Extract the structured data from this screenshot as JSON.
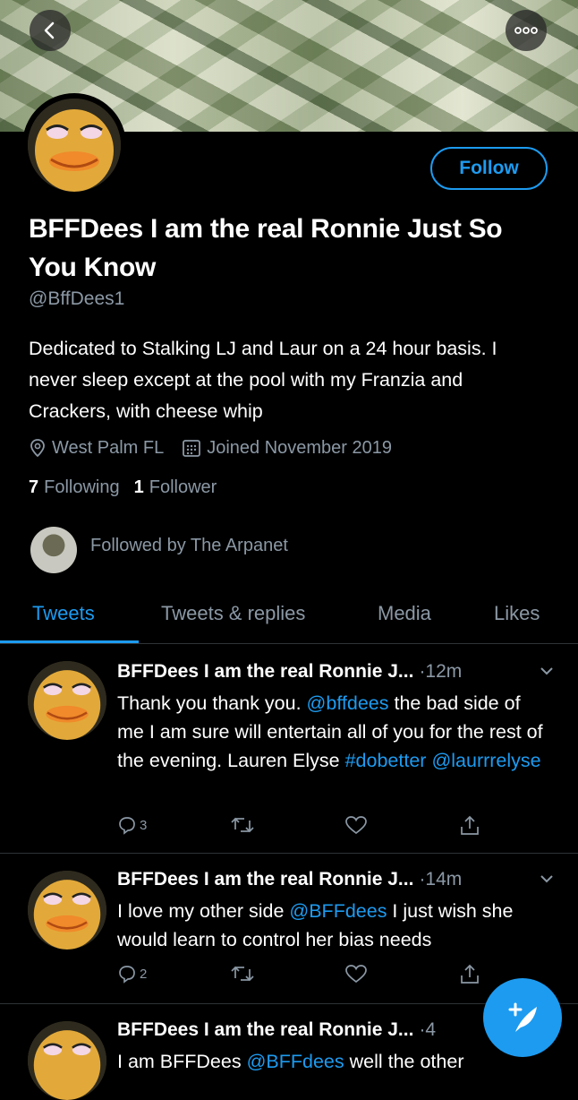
{
  "profile": {
    "display_name": "BFFDees I am the real Ronnie Just So You Know",
    "handle": "@BffDees1",
    "bio": "Dedicated to Stalking LJ and Laur on a 24 hour basis. I never sleep except at the pool with my Franzia and Crackers, with cheese whip",
    "location": "West Palm FL",
    "joined": "Joined November 2019",
    "following_count": "7",
    "following_label": "Following",
    "followers_count": "1",
    "followers_label": "Follower",
    "followed_by": "Followed by The Arpanet",
    "follow_button": "Follow"
  },
  "tabs": [
    {
      "label": "Tweets",
      "active": true
    },
    {
      "label": "Tweets & replies",
      "active": false
    },
    {
      "label": "Media",
      "active": false
    },
    {
      "label": "Likes",
      "active": false
    }
  ],
  "tweets": [
    {
      "name": "BFFDees I am the real Ronnie J...",
      "time": "·12m",
      "reply_count": "3",
      "segments": [
        {
          "t": "Thank you thank you.  ",
          "link": false
        },
        {
          "t": "@bffdees",
          "link": true
        },
        {
          "t": " the bad side of me I am sure will entertain all of you for the rest of the evening.  Lauren Elyse ",
          "link": false
        },
        {
          "t": "#dobetter",
          "link": true
        },
        {
          "t": " ",
          "link": false
        },
        {
          "t": "@laurrrelyse",
          "link": true
        }
      ]
    },
    {
      "name": "BFFDees I am the real Ronnie J...",
      "time": "·14m",
      "reply_count": "2",
      "segments": [
        {
          "t": "I love my other side ",
          "link": false
        },
        {
          "t": "@BFFdees",
          "link": true
        },
        {
          "t": " I just wish she would learn to control her bias needs",
          "link": false
        }
      ]
    },
    {
      "name": "BFFDees I am the real Ronnie J...",
      "time": "·4",
      "reply_count": "",
      "segments": [
        {
          "t": "I am BFFDees ",
          "link": false
        },
        {
          "t": "@BFFdees",
          "link": true
        },
        {
          "t": " well the other",
          "link": false
        }
      ]
    }
  ],
  "colors": {
    "accent": "#1d9bf0",
    "secondary_text": "#8b98a5",
    "background": "#000000"
  },
  "icons": [
    "back-arrow-icon",
    "more-options-icon",
    "location-pin-icon",
    "calendar-icon",
    "reply-icon",
    "retweet-icon",
    "like-icon",
    "share-icon",
    "compose-tweet-icon"
  ]
}
